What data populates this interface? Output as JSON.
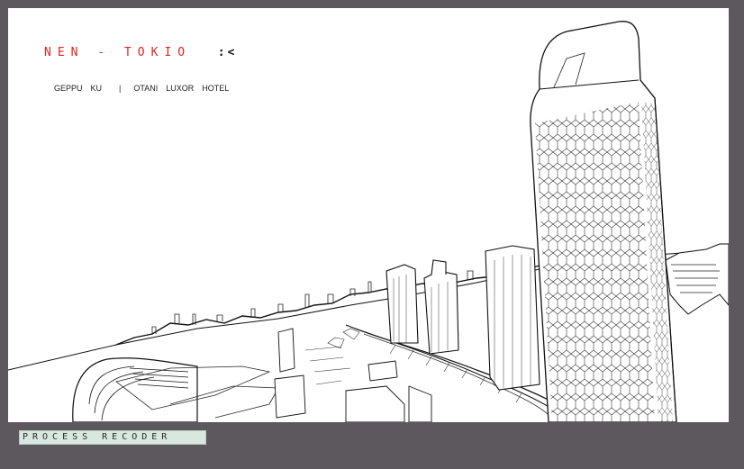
{
  "header": {
    "title": "NEN - TOKIO",
    "back_mark": ":<"
  },
  "subnav": {
    "items": [
      "GEPPU",
      "KU"
    ],
    "separator": "|",
    "items2": [
      "OTANI",
      "LUXOR",
      "HOTEL"
    ]
  },
  "footer": {
    "process_label": "PROCESS RECODER"
  },
  "colors": {
    "frame": "#5d585d",
    "title_red": "#e2231a",
    "process_bg": "#d8e8e0"
  }
}
